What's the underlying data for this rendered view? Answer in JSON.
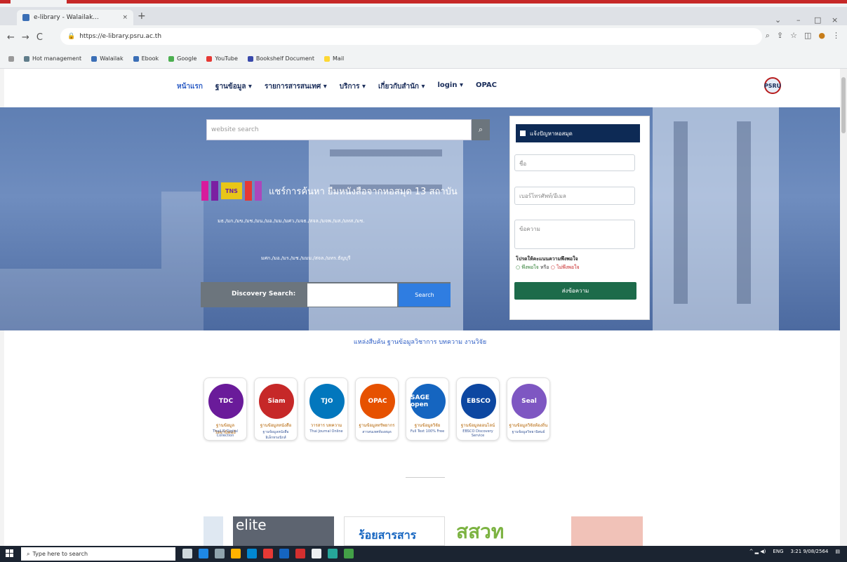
{
  "browser": {
    "tab_title": "e-library - Walailak...",
    "tab_close": "×",
    "new_tab": "+",
    "url": "https://e-library.psru.ac.th",
    "window_controls": [
      "⌄",
      "–",
      "□",
      "×"
    ],
    "nav": [
      "←",
      "→",
      "C"
    ],
    "bookmarks": [
      "Hot management",
      "Walailak",
      "Ebook",
      "Google",
      "YouTube",
      "Bookshelf Document",
      "Mail"
    ]
  },
  "site": {
    "menu": [
      "หน้าแรก",
      "ฐานข้อมูล ▾",
      "รายการสารสนเทศ ▾",
      "บริการ ▾",
      "เกี่ยวกับสำนัก ▾",
      "login ▾",
      "OPAC"
    ],
    "logo_text": "PSRU",
    "search_placeholder": "website search",
    "search_icon": "magnifier",
    "banner_mark": "TNS",
    "banner_text": "แชร์การค้นหา ยืมหนังสือจากหอสมุด 13 สถาบัน",
    "banner_sub1": "มธ./มก./มข./มช./มน./มอ./มม./มศว./มจธ./สจล./มจพ./มส./มทส./มช.",
    "banner_sub2": "มศก./มอ./มร./มช./มมม./สจล./มทร.ธัญบุรี",
    "discovery_label": "Discovery Search:",
    "discovery_button": "Search"
  },
  "panel": {
    "title": "แจ้งปัญหาหอสมุด",
    "name_placeholder": "ชื่อ",
    "contact_placeholder": "เบอร์โทรศัพท์/อีเมล",
    "message_placeholder": "ข้อความ",
    "note": "โปรดให้คะแนนความพึงพอใจ",
    "radio_yes": "○ พึงพอใจ",
    "radio_mid": "หรือ",
    "radio_no": "○ ไม่พึงพอใจ",
    "send_button": "ส่งข้อความ"
  },
  "databases": {
    "heading": "แหล่งสืบค้น ฐานข้อมูลวิชาการ บทความ งานวิจัย",
    "items": [
      {
        "art": "TDC",
        "cap1": "ฐานข้อมูลวิทยานิพนธ์",
        "cap2": "ThaiLIS Digital Collection",
        "color": "#6a1b9a"
      },
      {
        "art": "Siam",
        "cap1": "ฐานข้อมูลหนังสือ",
        "cap2": "ฐานข้อมูลหนังสืออิเล็กทรอนิกส์",
        "color": "#c62828"
      },
      {
        "art": "TJO",
        "cap1": "วารสาร บทความ",
        "cap2": "Thai Journal Online",
        "color": "#0277bd"
      },
      {
        "art": "OPAC",
        "cap1": "ฐานข้อมูลทรัพยากร",
        "cap2": "สารสนเทศห้องสมุด",
        "color": "#e65100"
      },
      {
        "art": "SAGE open",
        "cap1": "ฐานข้อมูลวิจัย",
        "cap2": "Full Text 100% Free",
        "color": "#1565c0"
      },
      {
        "art": "EBSCO",
        "cap1": "ฐานข้อมูลออนไลน์",
        "cap2": "EBSCO Discovery Service",
        "color": "#0d47a1"
      },
      {
        "art": "Seal",
        "cap1": "ฐานข้อมูลวิจัยท้องถิ่น",
        "cap2": "ฐานข้อมูลวิทยานิพนธ์",
        "color": "#7e57c2"
      }
    ]
  },
  "bottom": [
    "elite",
    "ร้อยสารสาร",
    "สสวท"
  ],
  "taskbar": {
    "search_placeholder": "Type here to search",
    "time": "3:21",
    "date": "9/08/2564",
    "lang": "ENG"
  }
}
